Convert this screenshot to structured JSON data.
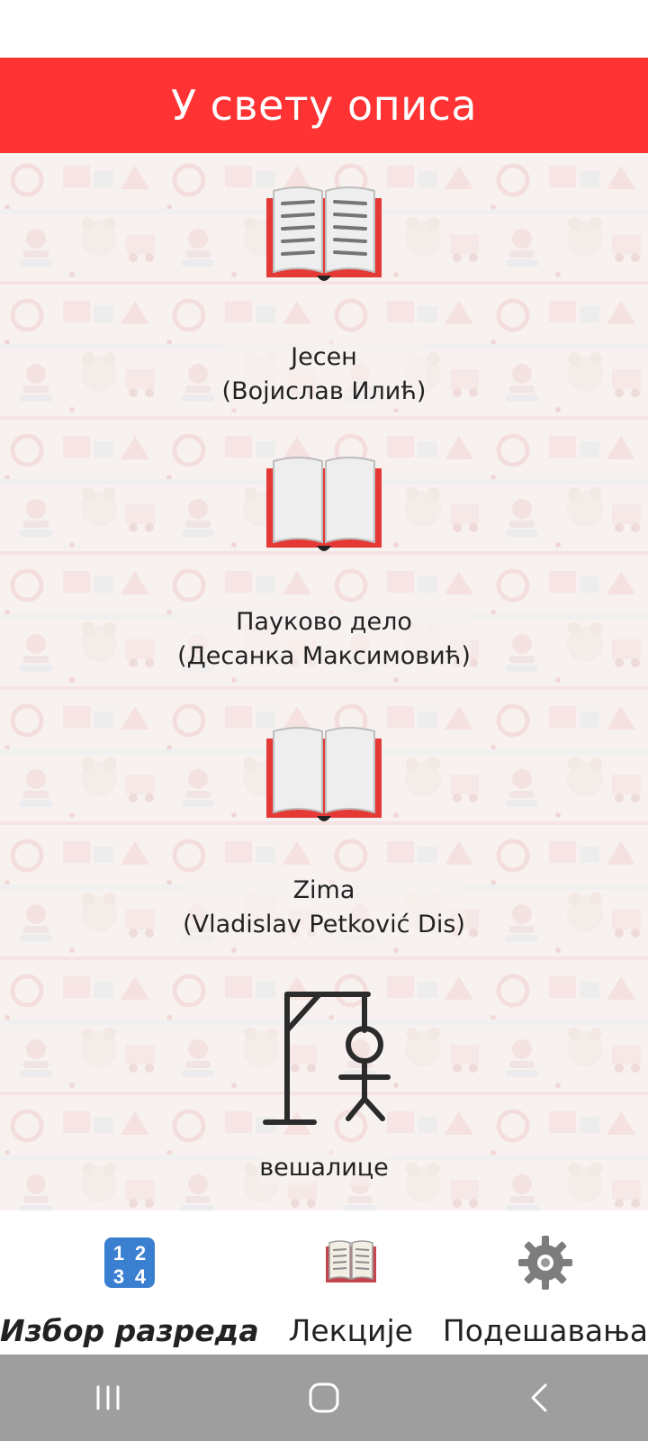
{
  "header": {
    "title": "У свету описа"
  },
  "lessons": [
    {
      "title": "Јесен",
      "author": "(Војислав Илић)",
      "icon": "open-book-icon"
    },
    {
      "title": "Пауково дело",
      "author": "(Десанка Максимовић)",
      "icon": "open-book-icon"
    },
    {
      "title": "Zima",
      "author": "(Vladislav Petković Dis)",
      "icon": "open-book-icon"
    },
    {
      "title": "вешалице",
      "author": "",
      "icon": "hangman-icon"
    }
  ],
  "bottom_nav": [
    {
      "label": "Избор разреда",
      "icon": "numbers-1234-icon",
      "active": true
    },
    {
      "label": "Лекције",
      "icon": "book-icon",
      "active": false
    },
    {
      "label": "Подешавања",
      "icon": "gear-icon",
      "active": false
    }
  ],
  "system_nav": [
    "recent-apps-icon",
    "home-icon",
    "back-icon"
  ],
  "colors": {
    "accent": "#ff3333",
    "book_red": "#e53935",
    "system_bar": "#9e9e9e"
  }
}
